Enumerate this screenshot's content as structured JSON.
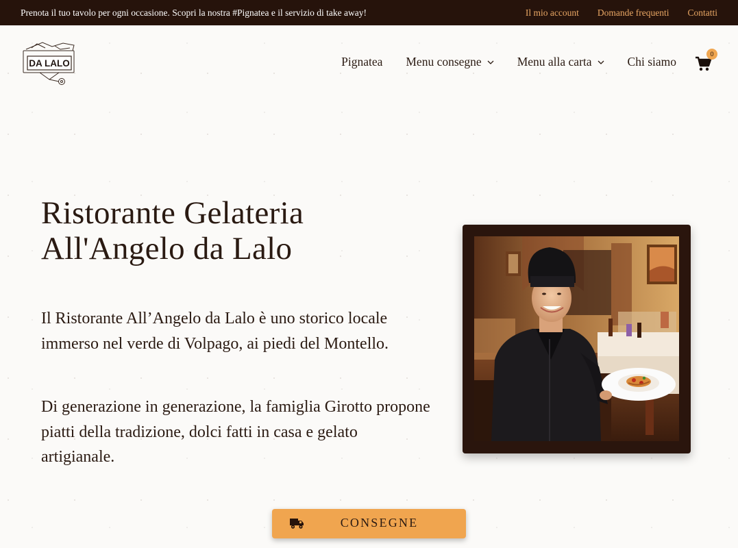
{
  "topbar": {
    "message": "Prenota il tuo tavolo per ogni occasione. Scopri la nostra #Pignatea e il servizio di take away!",
    "links": [
      "Il mio account",
      "Domande frequenti",
      "Contatti"
    ]
  },
  "logo": {
    "text": "DA LALO"
  },
  "nav": {
    "items": [
      {
        "label": "Pignatea",
        "has_dropdown": false
      },
      {
        "label": "Menu consegne",
        "has_dropdown": true
      },
      {
        "label": "Menu alla carta",
        "has_dropdown": true
      },
      {
        "label": "Chi siamo",
        "has_dropdown": false
      }
    ],
    "cart_icon": "shopping-cart-icon",
    "cart_count": "0"
  },
  "hero": {
    "title_line1": "Ristorante Gelateria",
    "title_line2": "All'Angelo da Lalo",
    "paragraph1": "Il Ristorante All’Angelo da Lalo è uno storico locale immerso nel verde di Volpago, ai piedi del Montello.",
    "paragraph2": "Di generazione in generazione, la famiglia Girotto propone piatti della tradizione, dolci fatti in casa e gelato artigianale."
  },
  "cta": {
    "label": "CONSEGNE",
    "icon": "delivery-truck-icon"
  },
  "colors": {
    "topbar_bg": "#26130b",
    "topbar_link": "#e9a764",
    "accent": "#f0a54f",
    "text": "#2a1a12",
    "frame": "#2a150d"
  }
}
